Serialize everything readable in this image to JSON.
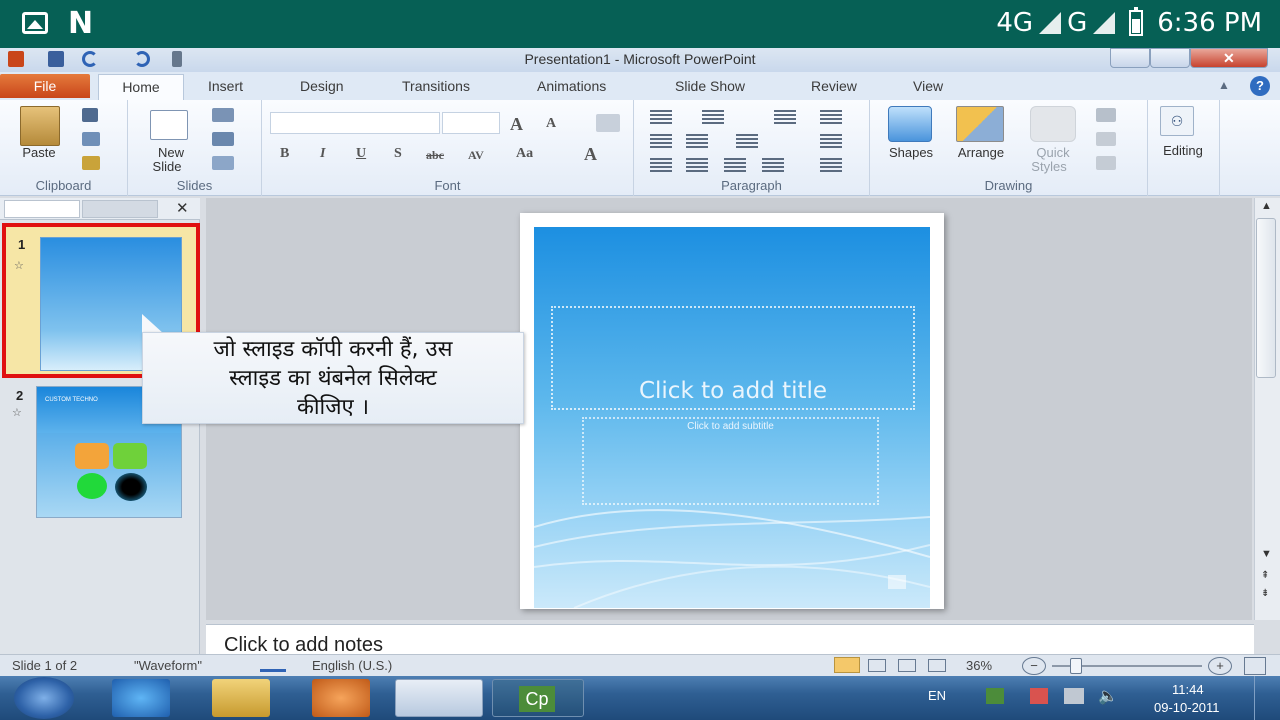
{
  "phone_status": {
    "network1": "4G",
    "network2": "G",
    "time": "6:36 PM"
  },
  "window": {
    "title": "Presentation1 - Microsoft PowerPoint"
  },
  "ribbon_tabs": [
    "File",
    "Home",
    "Insert",
    "Design",
    "Transitions",
    "Animations",
    "Slide Show",
    "Review",
    "View"
  ],
  "groups": {
    "clipboard": "Clipboard",
    "slides": "Slides",
    "font": "Font",
    "paragraph": "Paragraph",
    "drawing": "Drawing"
  },
  "buttons": {
    "paste": "Paste",
    "new_slide_1": "New",
    "new_slide_2": "Slide",
    "shapes": "Shapes",
    "arrange": "Arrange",
    "quick_styles_1": "Quick",
    "quick_styles_2": "Styles",
    "editing": "Editing"
  },
  "font_format": {
    "bold": "B",
    "italic": "I",
    "underline": "U",
    "strike": "S",
    "abc": "abc",
    "av": "AV",
    "case": "Aa",
    "grow": "A",
    "shrink": "A",
    "color": "A"
  },
  "thumbnails": [
    {
      "number": "1"
    },
    {
      "number": "2",
      "text": "CUSTOM TECHNO"
    }
  ],
  "callout_lines": [
    "जो स्लाइड कॉपी करनी हैं, उस",
    "स्लाइड का थंबनेल सिलेक्ट",
    "कीजिए ।"
  ],
  "slide": {
    "title_placeholder": "Click to add title",
    "subtitle_placeholder": "Click to add subtitle"
  },
  "notes_placeholder": "Click to add notes",
  "status": {
    "slide": "Slide 1 of 2",
    "theme": "\"Waveform\"",
    "language": "English (U.S.)",
    "zoom": "36%"
  },
  "taskbar": {
    "lang": "EN",
    "time": "11:44",
    "date": "09-10-2011",
    "cp": "Cp"
  }
}
